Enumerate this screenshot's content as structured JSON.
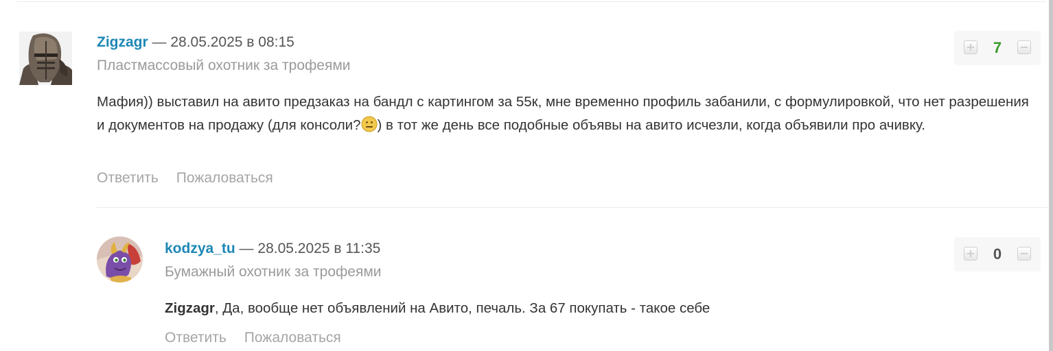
{
  "comments": [
    {
      "author": "Zigzagr",
      "separator": "—",
      "date": "28.05.2025 в 08:15",
      "rank": "Пластмассовый охотник за трофеями",
      "text_before_emoji": "Мафия)) выставил на авито предзаказ на бандл с картингом за 55к, мне временно профиль забанили, с формулировкой, что нет разрешения и документов на продажу (для консоли?",
      "emoji": "smile-emoji",
      "text_after_emoji": ") в тот же день все подобные объявы на авито исчезли, когда объявили про ачивку.",
      "score": "7",
      "actions": {
        "reply": "Ответить",
        "report": "Пожаловаться"
      }
    },
    {
      "author": "kodzya_tu",
      "separator": "—",
      "date": "28.05.2025 в 11:35",
      "rank": "Бумажный охотник за трофеями",
      "mention": "Zigzagr",
      "text": ", Да, вообще нет объявлений на Авито, печаль. За 67 покупать - такое себе",
      "score": "0",
      "actions": {
        "reply": "Ответить",
        "report": "Пожаловаться"
      }
    }
  ],
  "colors": {
    "author": "#1d87b5",
    "positive_score": "#3a9b2a",
    "muted": "#a5a5a5"
  }
}
